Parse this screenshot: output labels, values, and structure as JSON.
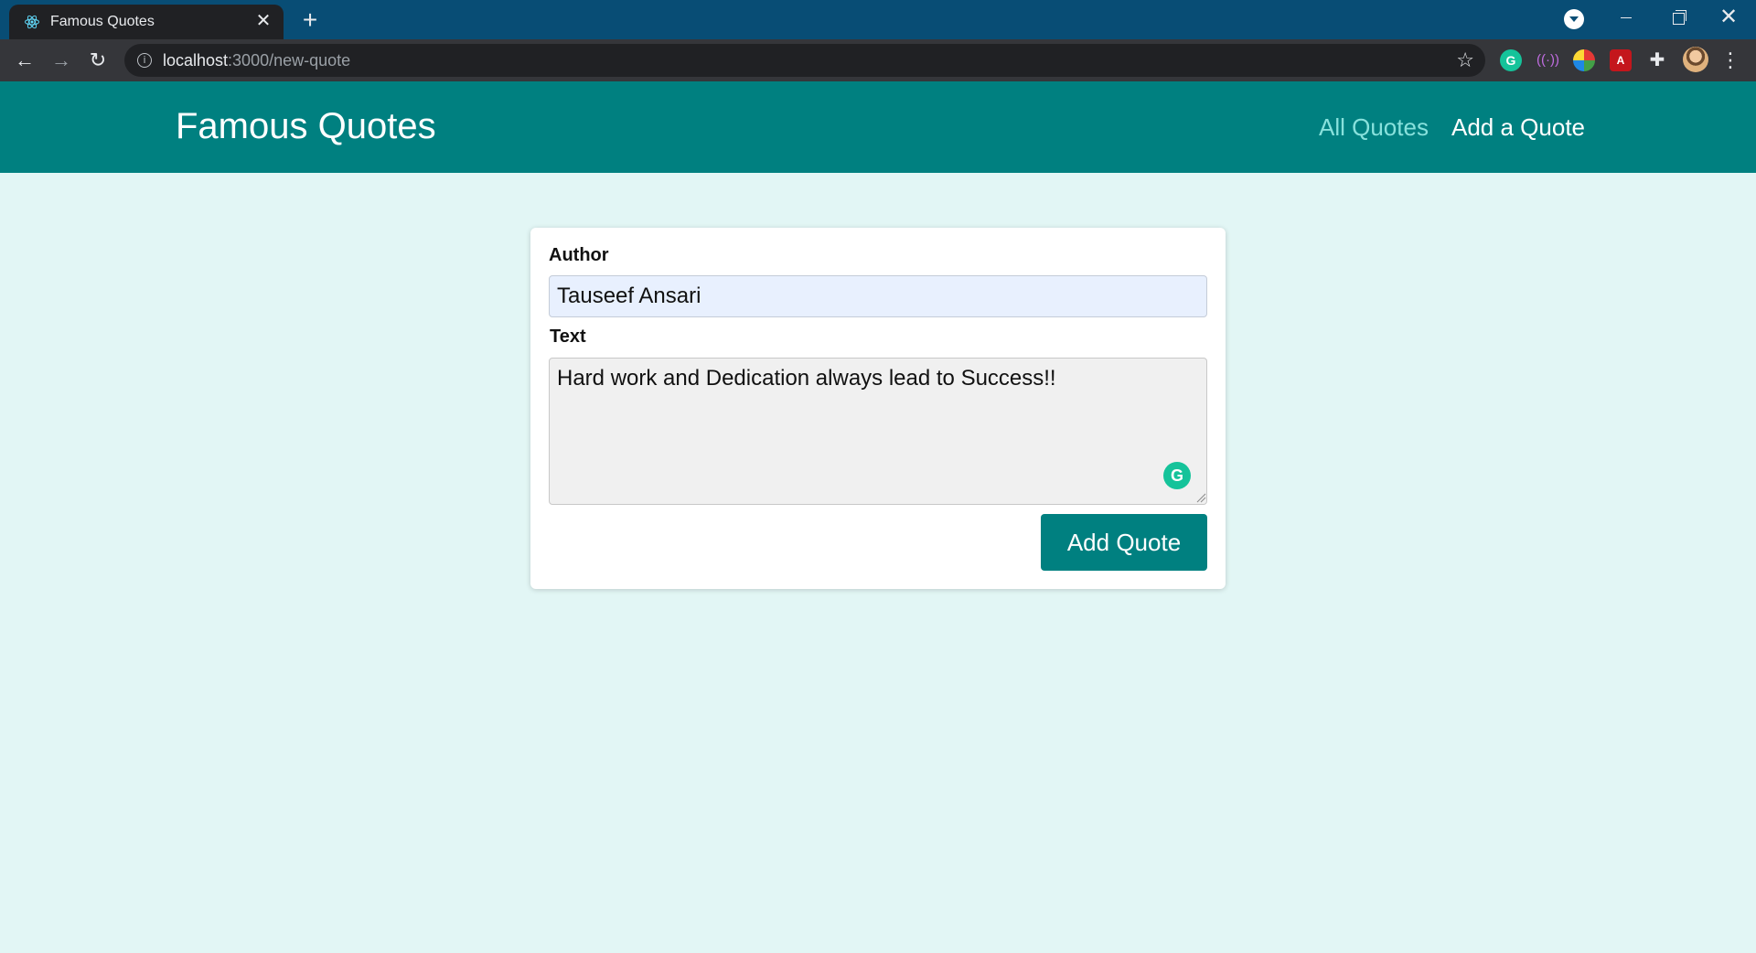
{
  "browser": {
    "tab_title": "Famous Quotes",
    "tab_close": "✕",
    "new_tab": "+",
    "url_host": "localhost",
    "url_path": ":3000/new-quote",
    "icons": {
      "favicon": "react-icon",
      "back": "←",
      "forward": "→",
      "reload": "↻",
      "bookmark": "☆",
      "menu": "⋮",
      "close": "✕"
    },
    "extensions": [
      "grammarly-icon",
      "wave-icon",
      "colorzilla-icon",
      "pdf-icon",
      "extensions-puzzle-icon"
    ]
  },
  "header": {
    "brand": "Famous Quotes",
    "nav": {
      "all_quotes": "All Quotes",
      "add_quote": "Add a Quote"
    }
  },
  "form": {
    "author_label": "Author",
    "author_value": "Tauseef Ansari",
    "text_label": "Text",
    "text_value": "Hard work and Dedication always lead to Success!!",
    "submit_label": "Add Quote"
  },
  "colors": {
    "header_bg": "#008080",
    "page_bg": "#e2f6f5",
    "active_nav": "#88e1dc",
    "tabstrip": "#084d75"
  }
}
